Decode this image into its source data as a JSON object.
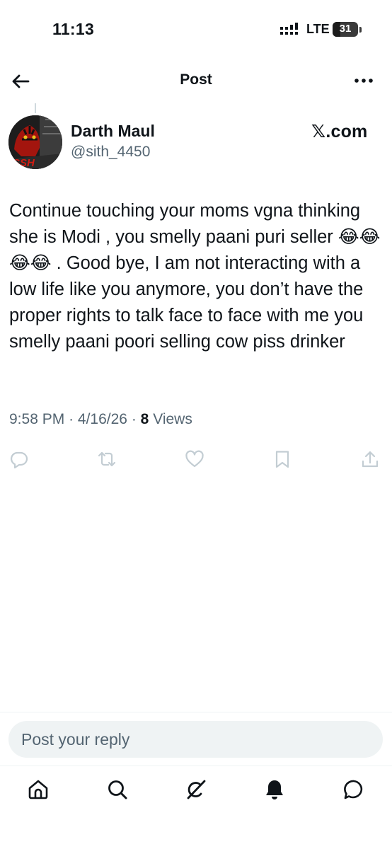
{
  "status_bar": {
    "time": "11:13",
    "network": "LTE",
    "battery": "31",
    "battery_level": 0.31
  },
  "header": {
    "title": "Post",
    "back_icon": "arrow-left-icon",
    "more_icon": "more-horizontal-icon"
  },
  "author": {
    "display_name": "Darth Maul",
    "handle": "@sith_4450",
    "avatar_text": "SSH"
  },
  "source_label": "𝕏.com",
  "post": {
    "text": "Continue touching your moms vgna thinking she is Modi , you smelly paani puri seller 😂😂😂😂 . Good bye, I am not interacting with a low life like you anymore, you don’t have the proper rights to talk face to face with me you smelly paani poori selling cow piss drinker",
    "time": "9:58 PM",
    "date": "4/16/26",
    "views_count": "8",
    "views_label": "Views",
    "separator": "·"
  },
  "actions": [
    "reply-icon",
    "repost-icon",
    "like-icon",
    "bookmark-icon",
    "share-icon"
  ],
  "reply": {
    "placeholder": "Post your reply"
  },
  "bottom_nav": [
    "home-icon",
    "search-icon",
    "grok-icon",
    "notifications-icon",
    "messages-icon"
  ],
  "colors": {
    "text": "#0f1419",
    "secondary": "#536471",
    "divider": "#eff3f4",
    "action": "#c3cdd3"
  }
}
